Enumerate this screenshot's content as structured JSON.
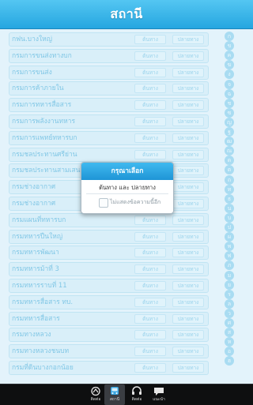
{
  "header": {
    "title": "สถานี"
  },
  "stations": [
    "กฟน.บางใหญ่",
    "กรมการขนส่งทางบก",
    "กรมการขนส่ง",
    "กรมการค้าภายใน",
    "กรมการทหารสื่อสาร",
    "กรมการพลังงานทหาร",
    "กรมการแพทย์ทหารบก",
    "กรมชลประทานศรีย่าน",
    "กรมชลประทานสามเสน",
    "กรมช่างอากาศ",
    "กรมช่างอากาศ",
    "กรมแผนที่ทหารบก",
    "กรมทหารปืนใหญ่",
    "กรมทหารพัฒนา",
    "กรมทหารม้าที่ 3",
    "กรมทหารราบที่ 11",
    "กรมทหารสื่อสาร ทบ.",
    "กรมทหารสื่อสาร",
    "กรมทางหลวง",
    "กรมทางหลวงชนบท",
    "กรมที่ดินบางกอกน้อย"
  ],
  "row_buttons": {
    "origin": "ต้นทาง",
    "destination": "ปลายทาง"
  },
  "index_letters": [
    "ก",
    "ข",
    "ค",
    "ฆ",
    "ง",
    "จ",
    "ฉ",
    "ช",
    "ซ",
    "ญ",
    "ฐ",
    "ฒ",
    "ณ",
    "ด",
    "ต",
    "ถ",
    "ท",
    "ธ",
    "น",
    "บ",
    "ป",
    "ผ",
    "พ",
    "ฟ",
    "ภ",
    "ม",
    "ย",
    "ร",
    "ล",
    "ว",
    "ศ",
    "ส",
    "ห",
    "อ",
    "ฮ"
  ],
  "dialog": {
    "title": "กรุณาเลือก",
    "option": "ต้นทาง และ ปลายทาง",
    "checkbox_label": "ไม่แสดงข้อความนี้อีก"
  },
  "tabbar": {
    "items": [
      {
        "label": "ติดต่อ",
        "icon": "route-icon",
        "active": false
      },
      {
        "label": "สถานี",
        "icon": "bus-icon",
        "active": true
      },
      {
        "label": "ติดต่อ",
        "icon": "headset-icon",
        "active": false
      },
      {
        "label": "แนะนำ",
        "icon": "chat-icon",
        "active": false
      }
    ]
  },
  "colors": {
    "header": "#25a6e0",
    "tabbar": "#0e0f10",
    "row_text": "#5fb6dc"
  }
}
